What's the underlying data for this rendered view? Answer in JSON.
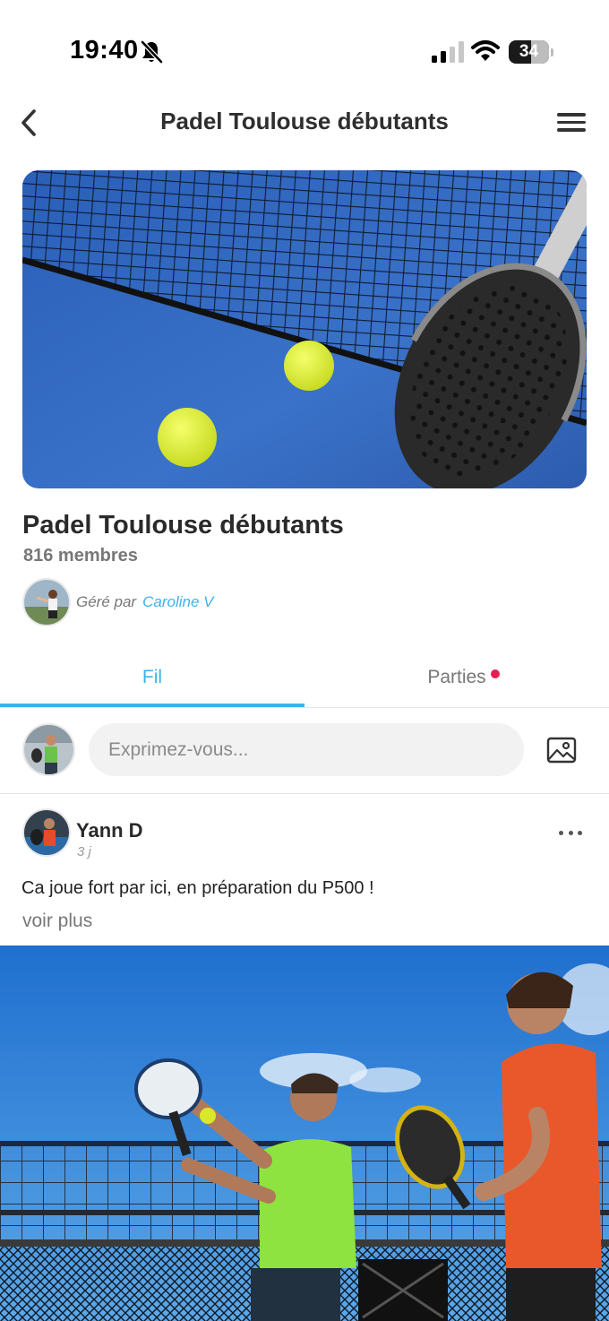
{
  "status_bar": {
    "time": "19:40",
    "battery_level": "34",
    "battery_fraction": 0.34
  },
  "nav": {
    "title": "Padel Toulouse débutants"
  },
  "group": {
    "name": "Padel Toulouse débutants",
    "members": "816 membres",
    "managed_by_label": "Géré par",
    "manager_name": "Caroline V"
  },
  "tabs": [
    {
      "label": "Fil",
      "active": true
    },
    {
      "label": "Parties",
      "active": false,
      "has_notification": true
    }
  ],
  "composer": {
    "placeholder": "Exprimez-vous..."
  },
  "post": {
    "author": "Yann D",
    "time": "3 j",
    "text": "Ca joue fort par ici, en préparation du P500 !",
    "see_more": "voir plus"
  },
  "colors": {
    "accent": "#3cb4e6",
    "notification": "#e51e4d",
    "text_primary": "#2a2a2a",
    "text_secondary": "#777777"
  },
  "icons": {
    "back": "chevron-left-icon",
    "menu": "hamburger-menu-icon",
    "bell": "bell-slash-icon",
    "image": "image-icon",
    "more": "ellipsis-icon"
  }
}
